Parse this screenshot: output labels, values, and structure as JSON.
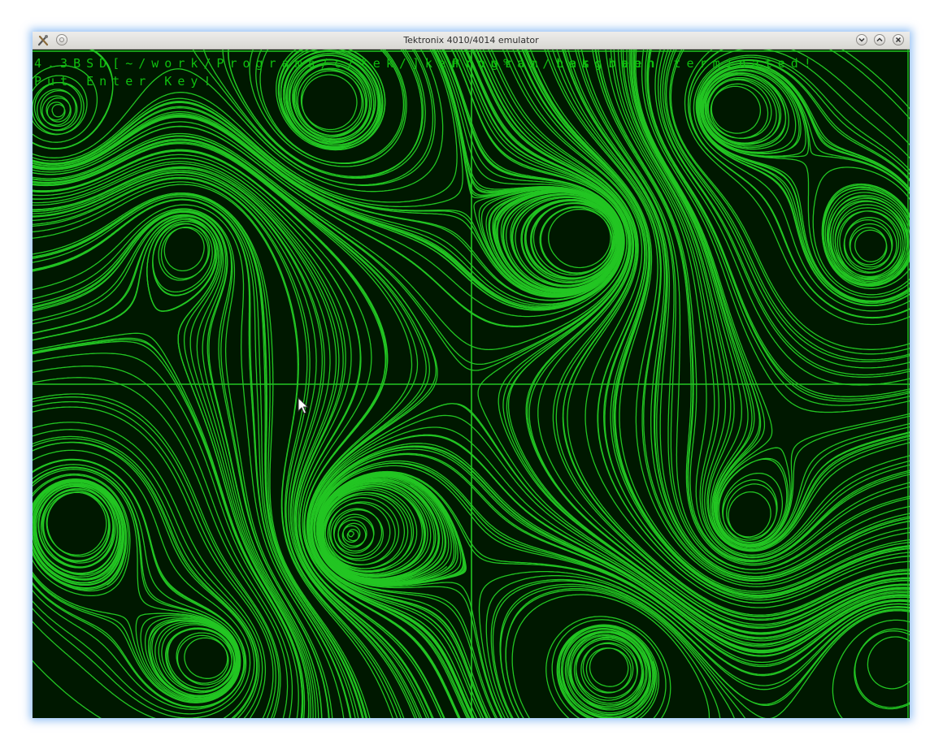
{
  "window": {
    "title": "Tektronix 4010/4014 emulator"
  },
  "terminal": {
    "line1": "4.3BSD[~/work/Programs/c/tek/]kenrou% ./tekgraph",
    "line1_overlay": "Program has been terminated!",
    "line2": "Put Enter Key!"
  },
  "icons": {
    "app": "tools-icon",
    "menu": "circle-menu-icon",
    "minimize": "chevron-down-icon",
    "maximize": "chevron-up-icon",
    "close": "close-icon",
    "pointer": "mouse-pointer-icon"
  },
  "colors": {
    "trace": "#22c522",
    "screen_bg": "#001800",
    "text": "#0fbf0f"
  }
}
